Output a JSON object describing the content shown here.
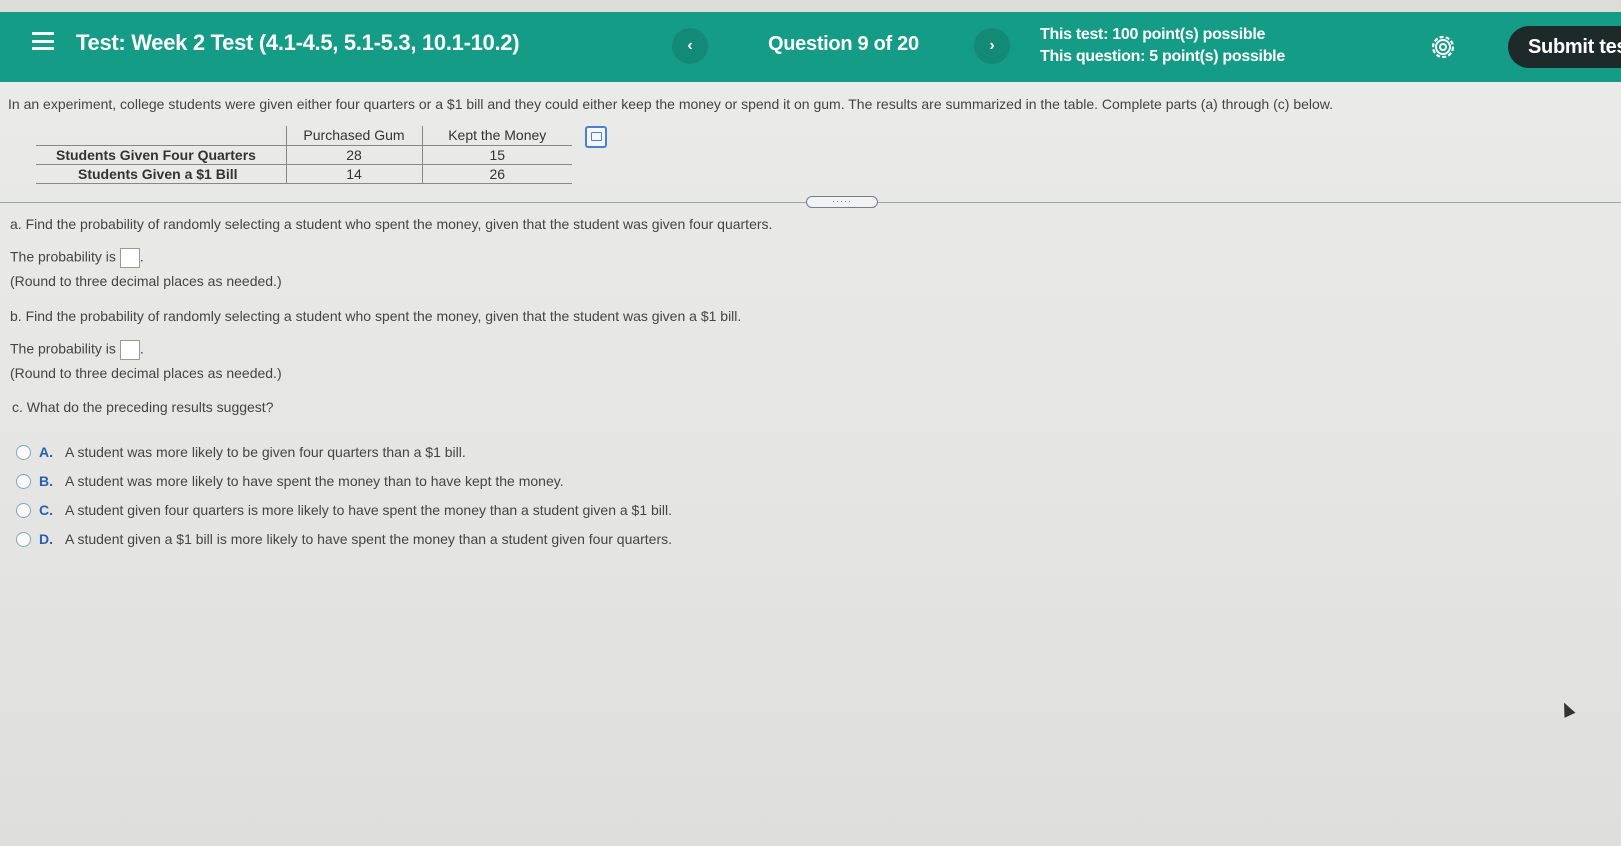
{
  "header": {
    "title": "Test:  Week 2 Test (4.1-4.5, 5.1-5.3, 10.1-10.2)",
    "question_counter": "Question 9 of 20",
    "prev_symbol": "‹",
    "next_symbol": "›",
    "test_points": "This test: 100 point(s) possible",
    "question_points": "This question: 5 point(s) possible",
    "submit_label": "Submit test",
    "colors": {
      "bar": "#159c86",
      "submit": "#1e2a2a"
    }
  },
  "problem": {
    "intro": "In an experiment, college students were given either four quarters or a $1 bill and they could either keep the money or spend it on gum. The results are summarized in the table. Complete parts (a) through (c) below.",
    "table": {
      "columns": [
        "Purchased Gum",
        "Kept the Money"
      ],
      "rows": [
        {
          "label": "Students Given Four Quarters",
          "values": [
            "28",
            "15"
          ]
        },
        {
          "label": "Students Given a $1 Bill",
          "values": [
            "14",
            "26"
          ]
        }
      ]
    },
    "handle_dots": "·····"
  },
  "part_a": {
    "question": "a. Find the probability of randomly selecting a student who spent the money, given that the student was given four quarters.",
    "answer_prefix": "The probability is",
    "answer_suffix": ".",
    "hint": "(Round to three decimal places as needed.)"
  },
  "part_b": {
    "question": "b. Find the probability of randomly selecting a student who spent the money, given that the student was given a $1 bill.",
    "answer_prefix": "The probability is",
    "answer_suffix": ".",
    "hint": "(Round to three decimal places as needed.)"
  },
  "part_c": {
    "question": "c. What do the preceding results suggest?",
    "options": [
      {
        "letter": "A.",
        "text": "A student was more likely to be given four quarters than a $1 bill."
      },
      {
        "letter": "B.",
        "text": "A student was more likely to have spent the money than to have kept the money."
      },
      {
        "letter": "C.",
        "text": "A student given four quarters is more likely to have spent the money than a student given a $1 bill."
      },
      {
        "letter": "D.",
        "text": "A student given a $1 bill is more likely to have spent the money than a student given four quarters."
      }
    ]
  }
}
